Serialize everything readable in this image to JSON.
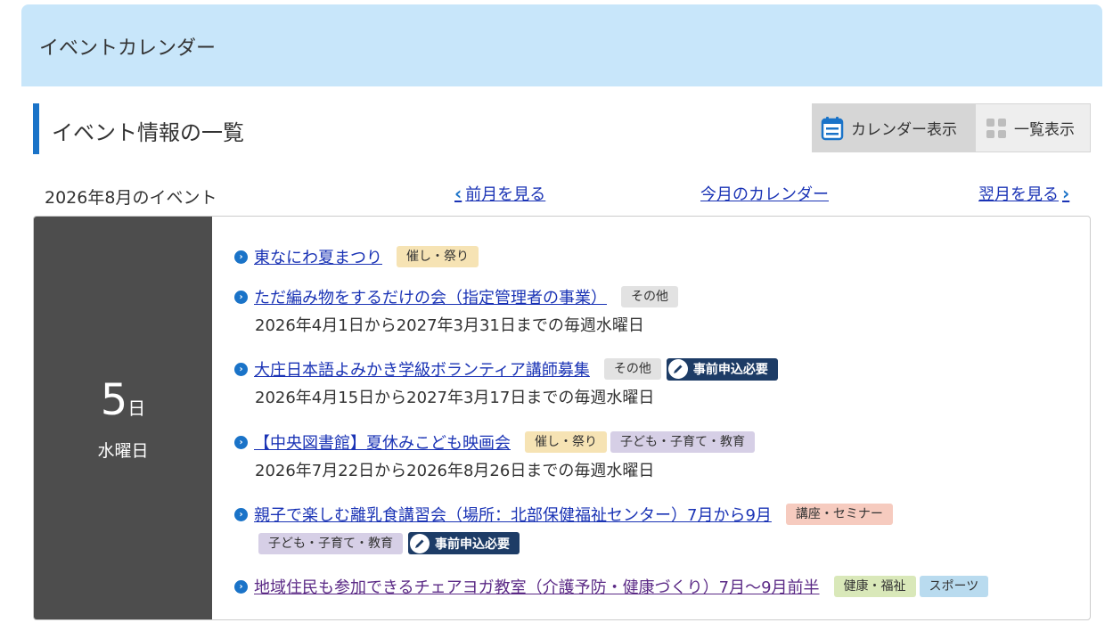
{
  "header": {
    "title": "イベントカレンダー"
  },
  "section": {
    "title": "イベント情報の一覧"
  },
  "view_toggle": {
    "calendar_label": "カレンダー表示",
    "list_label": "一覧表示",
    "active": "calendar"
  },
  "nav": {
    "month_label": "2026年8月のイベント",
    "prev_label": "前月を見る",
    "today_label": "今月のカレンダー",
    "next_label": "翌月を見る"
  },
  "day": {
    "number": "5",
    "unit": "日",
    "weekday": "水曜日"
  },
  "events": [
    {
      "title": "東なにわ夏まつり",
      "tags": [
        "催し・祭り"
      ]
    },
    {
      "title": "ただ編み物をするだけの会（指定管理者の事業）",
      "tags": [
        "その他"
      ],
      "schedule": "2026年4月1日から2027年3月31日までの毎週水曜日"
    },
    {
      "title": "大庄日本語よみかき学級ボランティア講師募集",
      "tags": [
        "その他"
      ],
      "badge": "事前申込必要",
      "schedule": "2026年4月15日から2027年3月17日までの毎週水曜日"
    },
    {
      "title": "【中央図書館】夏休みこども映画会",
      "tags": [
        "催し・祭り",
        "子ども・子育て・教育"
      ],
      "schedule": "2026年7月22日から2026年8月26日までの毎週水曜日"
    },
    {
      "title": "親子で楽しむ離乳食講習会（場所：北部保健福祉センター）7月から9月",
      "tags": [
        "講座・セミナー",
        "子ども・子育て・教育"
      ],
      "badge": "事前申込必要"
    },
    {
      "title": "地域住民も参加できるチェアヨガ教室（介護予防・健康づくり）7月～9月前半",
      "tags": [
        "健康・福祉",
        "スポーツ"
      ]
    }
  ],
  "colors": {
    "header_bg": "#c8e6fa",
    "accent": "#1a73c8",
    "link": "#1a33b5",
    "day_bg": "#4d4d4d",
    "badge_bg": "#1d3c66"
  },
  "icons": {
    "calendar_view": "calendar-icon",
    "list_view": "grid-icon",
    "prev": "chevron-left-icon",
    "next": "chevron-right-icon",
    "bullet": "chevron-circle-right-icon",
    "register": "pen-icon"
  }
}
